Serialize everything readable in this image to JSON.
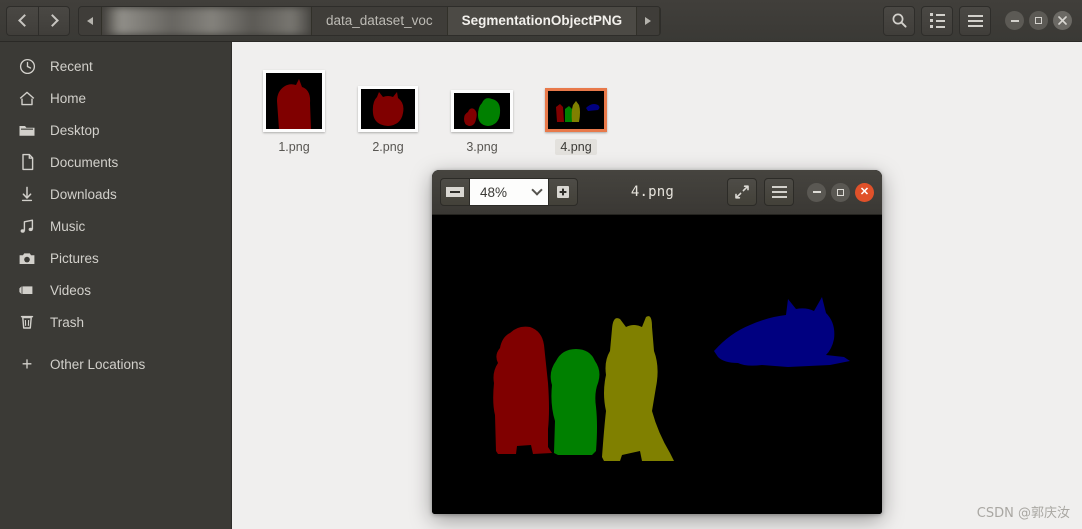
{
  "window": {
    "app": "Files",
    "nav": {
      "back": "back-arrow",
      "forward": "forward-arrow"
    },
    "breadcrumb": {
      "scroll_left_label": "◀",
      "blurred_segment": "",
      "items": [
        {
          "label": "data_dataset_voc",
          "active": false
        },
        {
          "label": "SegmentationObjectPNG",
          "active": true
        }
      ],
      "scroll_right_label": "▶"
    },
    "toolbar": {
      "search_label": "search-icon",
      "view_toggle_label": "list-view-icon",
      "menu_label": "menu-icon"
    },
    "controls": {
      "minimize": "–",
      "maximize": "□",
      "close": "×"
    }
  },
  "sidebar": {
    "items": [
      {
        "label": "Recent",
        "icon": "clock-icon"
      },
      {
        "label": "Home",
        "icon": "home-icon"
      },
      {
        "label": "Desktop",
        "icon": "folder-icon"
      },
      {
        "label": "Documents",
        "icon": "document-icon"
      },
      {
        "label": "Downloads",
        "icon": "download-icon"
      },
      {
        "label": "Music",
        "icon": "music-icon"
      },
      {
        "label": "Pictures",
        "icon": "camera-icon"
      },
      {
        "label": "Videos",
        "icon": "video-icon"
      },
      {
        "label": "Trash",
        "icon": "trash-icon"
      },
      {
        "label": "Other Locations",
        "icon": "plus-icon"
      }
    ]
  },
  "files": [
    {
      "name": "1.png",
      "selected": false
    },
    {
      "name": "2.png",
      "selected": false
    },
    {
      "name": "3.png",
      "selected": false
    },
    {
      "name": "4.png",
      "selected": true
    }
  ],
  "viewer": {
    "title": "4.png",
    "zoom_value": "48%",
    "zoom_out_label": "–",
    "zoom_in_label": "+",
    "fullscreen_label": "fullscreen-icon",
    "menu_label": "menu-icon",
    "controls": {
      "minimize": "–",
      "maximize": "□",
      "close": "×"
    }
  },
  "palette": {
    "mask_red": "#800000",
    "mask_green": "#008000",
    "mask_olive": "#808000",
    "mask_navy": "#000080",
    "image_background": "#000000",
    "selection_orange": "#e8794a",
    "sidebar_bg": "#3b3a36",
    "content_bg": "#f0efee"
  },
  "watermark": {
    "text": "CSDN @郭庆汝"
  }
}
